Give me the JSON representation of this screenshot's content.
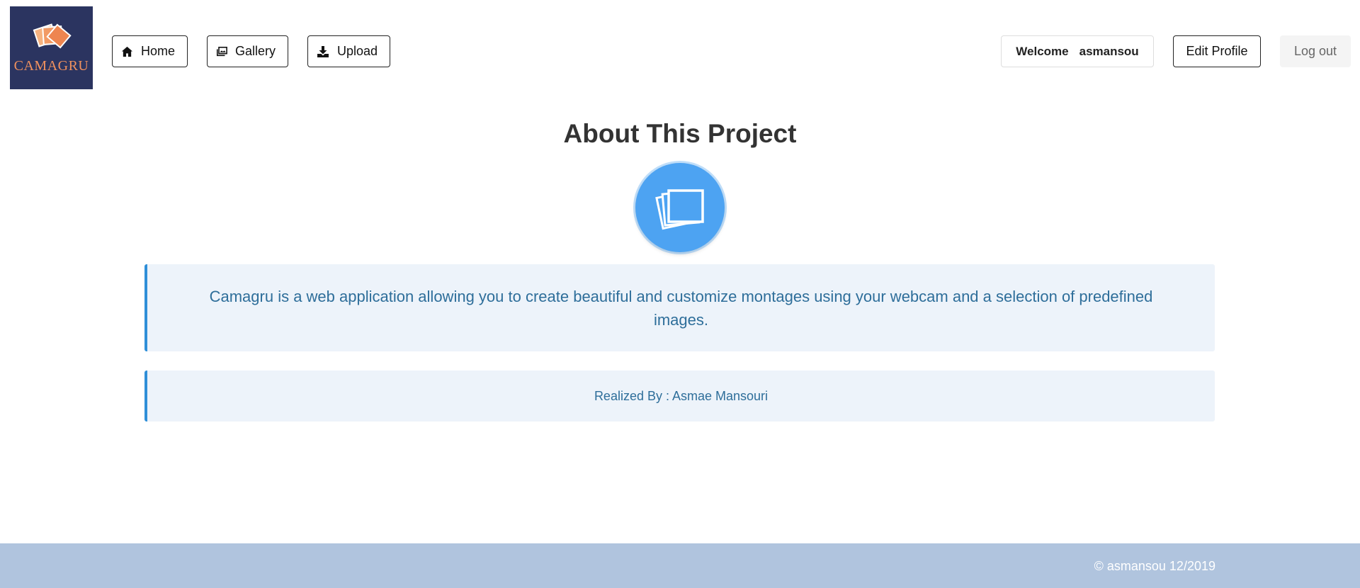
{
  "brand": {
    "name": "CAMAGRU",
    "logo_icon": "stacked-photos-icon"
  },
  "nav": {
    "home": {
      "label": "Home",
      "icon": "home-icon"
    },
    "gallery": {
      "label": "Gallery",
      "icon": "gallery-icon"
    },
    "upload": {
      "label": "Upload",
      "icon": "download-icon"
    }
  },
  "user": {
    "welcome_label": "Welcome",
    "username": "asmansou",
    "edit_profile_label": "Edit Profile",
    "logout_label": "Log out"
  },
  "main": {
    "title": "About This Project",
    "hero_icon": "photos-icon",
    "description": "Camagru is a web application allowing you to create beautiful and customize montages using your webcam and a selection of predefined images.",
    "author": "Realized By : Asmae Mansouri"
  },
  "footer": {
    "copyright": "© asmansou 12/2019"
  },
  "colors": {
    "accent": "#4da3f2",
    "card_border": "#2f8fd8",
    "card_bg": "#edf3fa",
    "footer_bg": "#b0c4de",
    "logo_bg": "#2b3460",
    "logo_text": "#f0915e"
  }
}
